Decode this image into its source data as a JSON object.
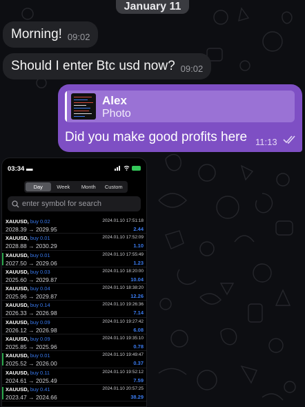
{
  "date_separator": "January 11",
  "messages": {
    "m1": {
      "text": "Morning!",
      "time": "09:02"
    },
    "m2": {
      "text": "Should I enter Btc usd now?",
      "time": "09:02"
    },
    "m3": {
      "reply_name": "Alex",
      "reply_sub": "Photo",
      "text": "Did you make good profits here",
      "time": "11:13"
    }
  },
  "photo": {
    "status_time": "03:34",
    "battery": "100",
    "tabs": [
      "Day",
      "Week",
      "Month",
      "Custom"
    ],
    "active_tab": "Day",
    "search_placeholder": "enter symbol for search",
    "rows": [
      {
        "symbol": "XAUUSD,",
        "side": "buy 0.02",
        "prices": "2028.39 → 2029.95",
        "datetime": "2024.01.10 17:51:18",
        "profit": "2.44",
        "marked": false
      },
      {
        "symbol": "XAUUSD,",
        "side": "buy 0.01",
        "prices": "2028.88 → 2030.29",
        "datetime": "2024.01.10 17:52:09",
        "profit": "1.10",
        "marked": false
      },
      {
        "symbol": "XAUUSD,",
        "side": "buy 0.01",
        "prices": "2027.50 → 2029.06",
        "datetime": "2024.01.10 17:55:49",
        "profit": "1.23",
        "marked": true
      },
      {
        "symbol": "XAUUSD,",
        "side": "buy 0.03",
        "prices": "2025.60 → 2029.87",
        "datetime": "2024.01.10 18:20:00",
        "profit": "10.04",
        "marked": false
      },
      {
        "symbol": "XAUUSD,",
        "side": "buy 0.04",
        "prices": "2025.96 → 2029.87",
        "datetime": "2024.01.10 18:38:20",
        "profit": "12.26",
        "marked": false
      },
      {
        "symbol": "XAUUSD,",
        "side": "buy 0.14",
        "prices": "2026.33 → 2026.98",
        "datetime": "2024.01.10 19:26:36",
        "profit": "7.14",
        "marked": false
      },
      {
        "symbol": "XAUUSD,",
        "side": "buy 0.09",
        "prices": "2026.12 → 2026.98",
        "datetime": "2024.01.10 19:27:42",
        "profit": "6.08",
        "marked": false
      },
      {
        "symbol": "XAUUSD,",
        "side": "buy 0.09",
        "prices": "2025.85 → 2025.96",
        "datetime": "2024.01.10 19:35:10",
        "profit": "0.78",
        "marked": false
      },
      {
        "symbol": "XAUUSD,",
        "side": "buy 0.01",
        "prices": "2025.52 → 2026.00",
        "datetime": "2024.01.10 19:49:47",
        "profit": "0.37",
        "marked": true
      },
      {
        "symbol": "XAUUSD,",
        "side": "buy 0.11",
        "prices": "2024.61 → 2025.49",
        "datetime": "2024.01.10 19:52:12",
        "profit": "7.59",
        "marked": false
      },
      {
        "symbol": "XAUUSD,",
        "side": "buy 0.41",
        "prices": "2023.47 → 2024.66",
        "datetime": "2024.01.10 20:57:25",
        "profit": "38.29",
        "marked": true
      }
    ]
  },
  "colors": {
    "outgoing": "#7e4fc4",
    "incoming": "#222327",
    "profit": "#3a7bf0"
  }
}
